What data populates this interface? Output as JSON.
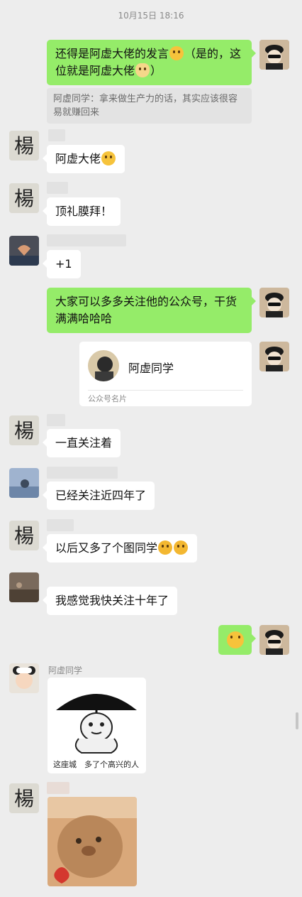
{
  "timestamp": "10月15日 18:16",
  "icons": {
    "emoji_smile": "smiling-face-emoji",
    "emoji_doge": "doge-emoji",
    "emoji_think": "thinking-face-emoji",
    "emoji_666": "666-emoji"
  },
  "colors": {
    "background": "#ededed",
    "self_bubble": "#95ec69",
    "other_bubble": "#ffffff",
    "quote_bg": "#e3e3e3"
  },
  "messages": {
    "m1": {
      "text": "还得是阿虚大佬的发言",
      "text2": "（是的，这位就是阿虚大佬",
      "tail": "）"
    },
    "m1_quote": {
      "text": "阿虚同学：拿来做生产力的话，其实应该很容易就赚回来"
    },
    "m2": {
      "text": "阿虚大佬"
    },
    "m3": {
      "text": "顶礼膜拜！"
    },
    "m4": {
      "text": "+1"
    },
    "m5": {
      "text": "大家可以多多关注他的公众号，干货满满哈哈哈"
    },
    "m6_card": {
      "title": "阿虚同学",
      "footer": "公众号名片"
    },
    "m7": {
      "text": "一直关注着"
    },
    "m8": {
      "text": "已经关注近四年了"
    },
    "m9": {
      "text": "以后又多了个图同学"
    },
    "m10": {
      "text": "我感觉我快关注十年了"
    },
    "m12": {
      "sender_name": "阿虚同学",
      "sticker_caption": "这座城　多了个高兴的人"
    }
  }
}
